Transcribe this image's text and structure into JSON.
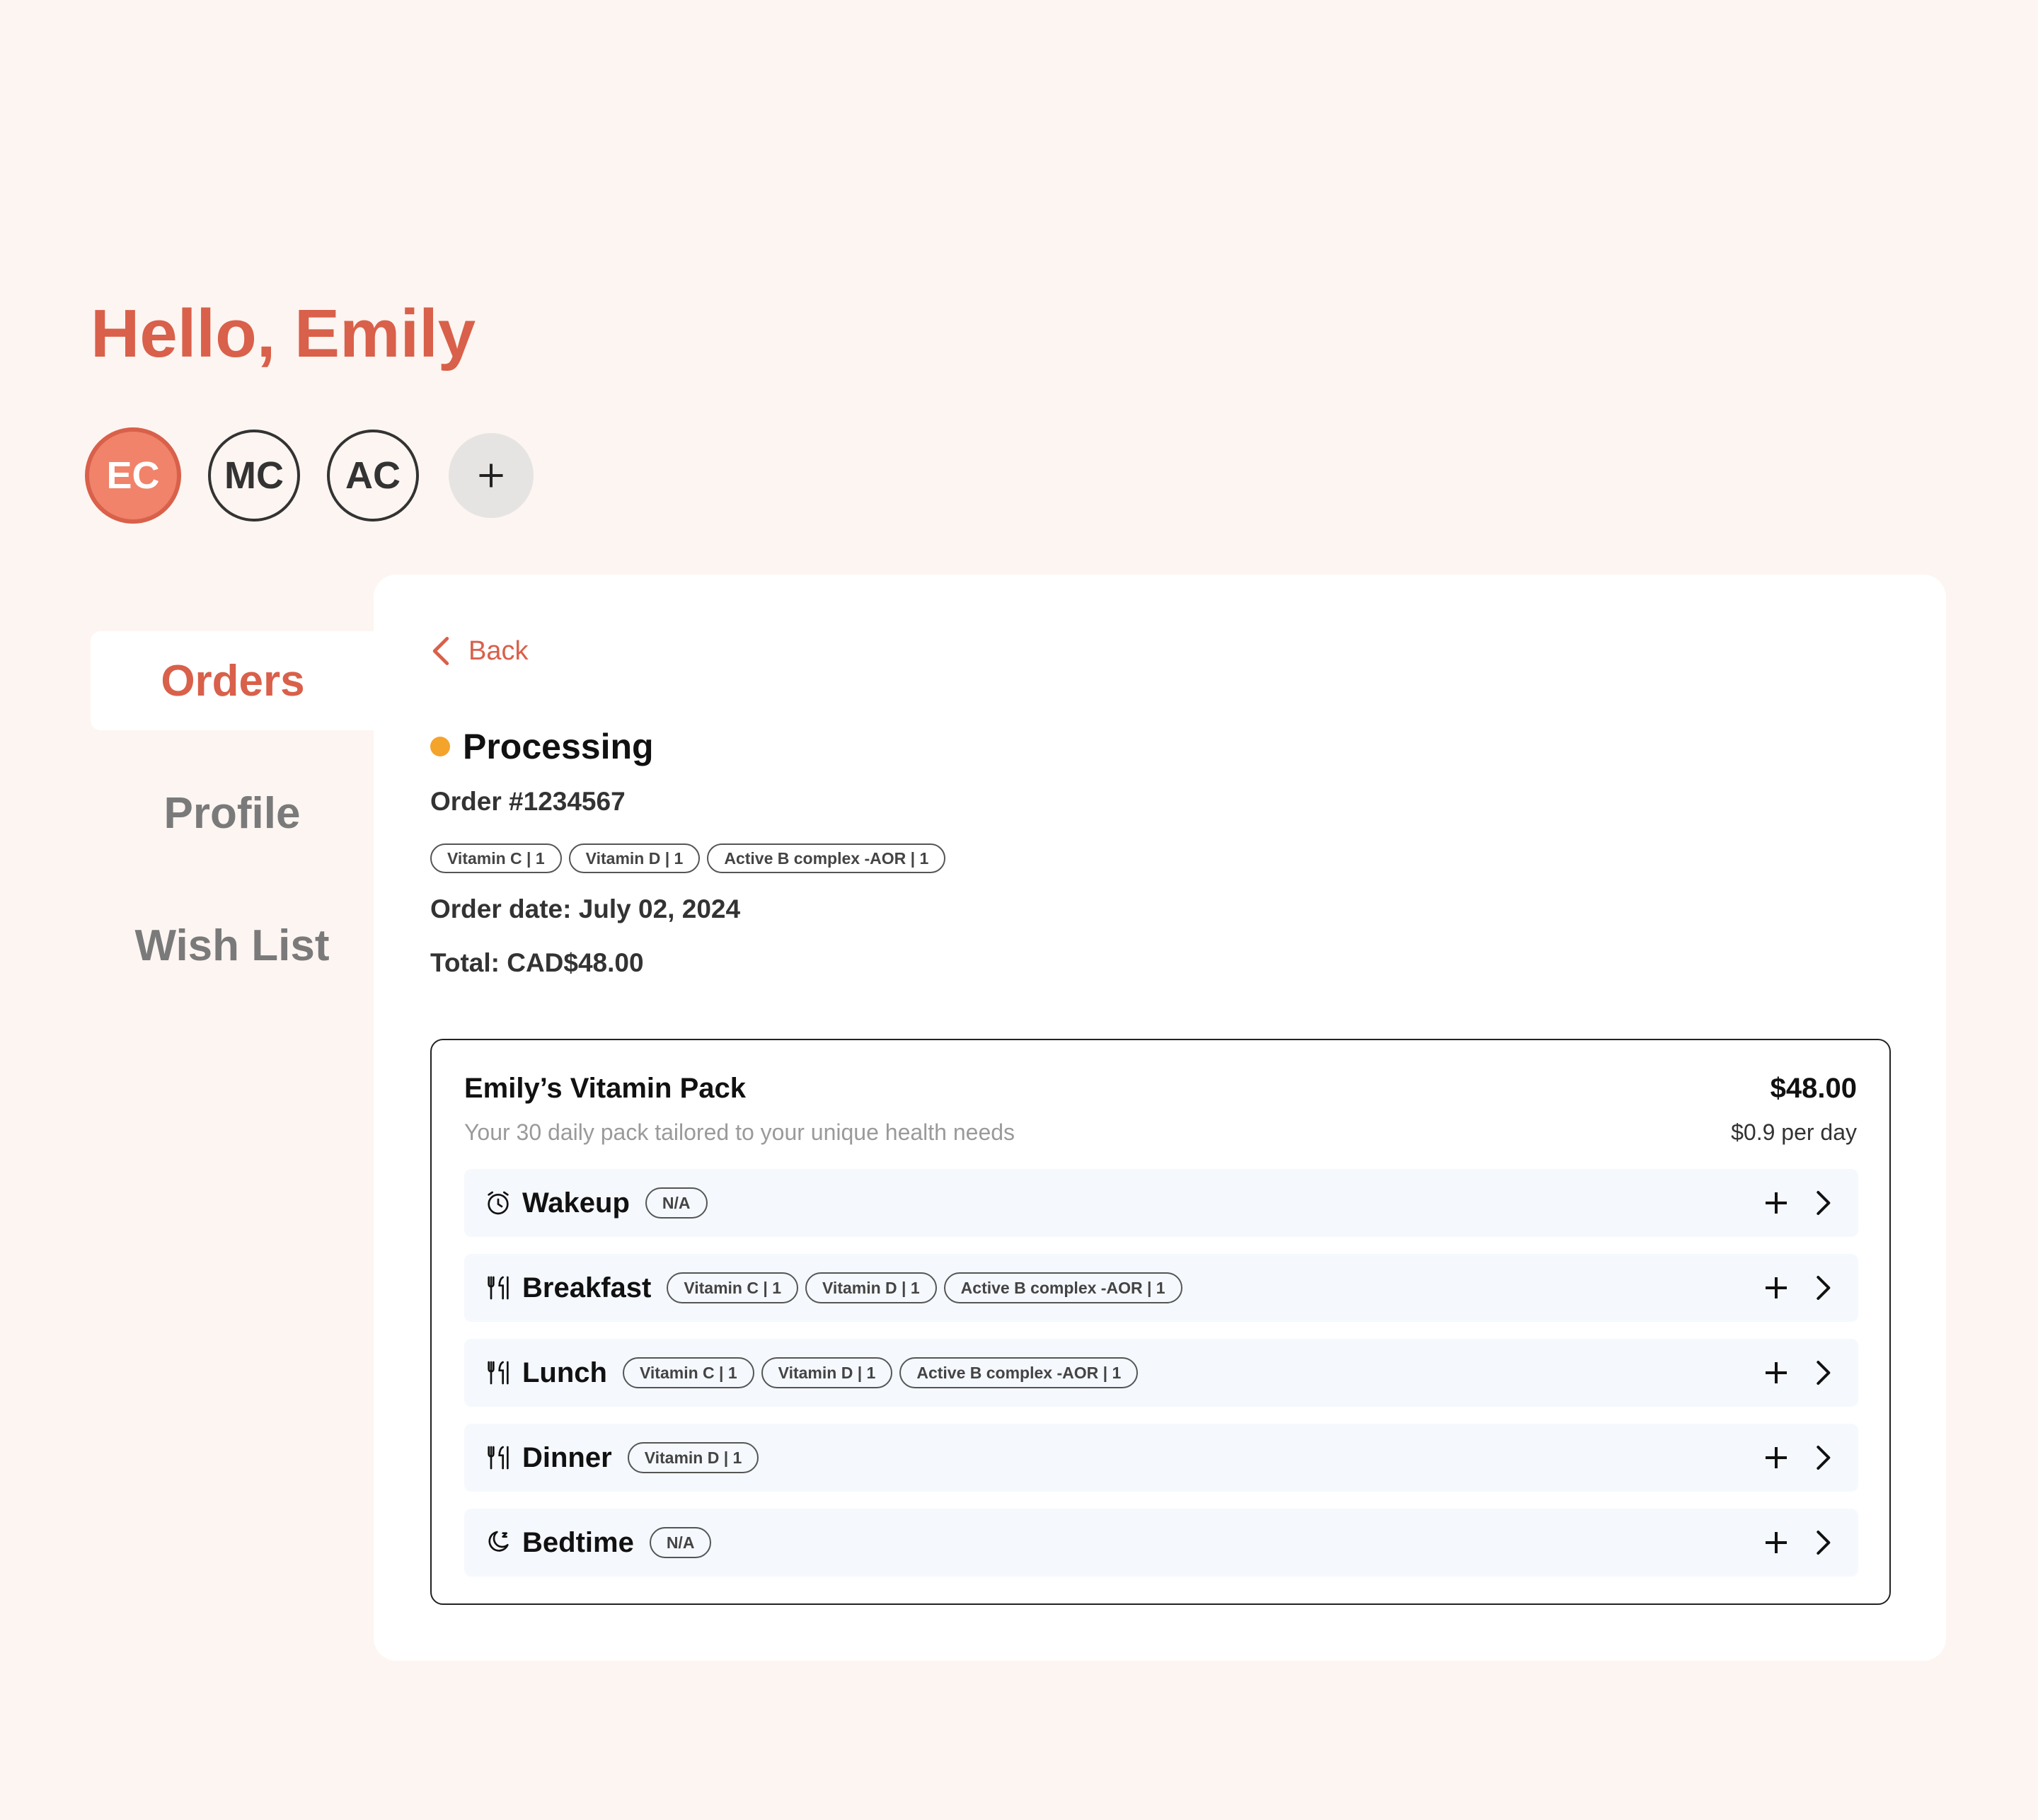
{
  "greeting": "Hello, Emily",
  "avatars": [
    {
      "initials": "EC",
      "active": true
    },
    {
      "initials": "MC",
      "active": false
    },
    {
      "initials": "AC",
      "active": false
    }
  ],
  "nav": {
    "orders": "Orders",
    "profile": "Profile",
    "wishlist": "Wish List"
  },
  "order": {
    "back_label": "Back",
    "status": "Processing",
    "status_color": "#f4a32b",
    "number": "Order #1234567",
    "tags": [
      "Vitamin C | 1",
      "Vitamin D | 1",
      "Active B complex -AOR | 1"
    ],
    "date": "Order date: July 02, 2024",
    "total": "Total: CAD$48.00"
  },
  "pack": {
    "title": "Emily’s Vitamin Pack",
    "subtitle": "Your 30 daily pack tailored to your unique health needs",
    "price": "$48.00",
    "per_day": "$0.9 per day",
    "slots": [
      {
        "label": "Wakeup",
        "icon": "alarm-clock-icon",
        "tags": [
          "N/A"
        ]
      },
      {
        "label": "Breakfast",
        "icon": "utensils-icon",
        "tags": [
          "Vitamin C | 1",
          "Vitamin D | 1",
          "Active B complex -AOR | 1"
        ]
      },
      {
        "label": "Lunch",
        "icon": "utensils-icon",
        "tags": [
          "Vitamin C | 1",
          "Vitamin D | 1",
          "Active B complex -AOR | 1"
        ]
      },
      {
        "label": "Dinner",
        "icon": "utensils-icon",
        "tags": [
          "Vitamin D | 1"
        ]
      },
      {
        "label": "Bedtime",
        "icon": "moon-icon",
        "tags": [
          "N/A"
        ]
      }
    ]
  },
  "colors": {
    "accent": "#d9604a",
    "background": "#fdf5f1",
    "slot_bg": "#f5f8fd"
  }
}
